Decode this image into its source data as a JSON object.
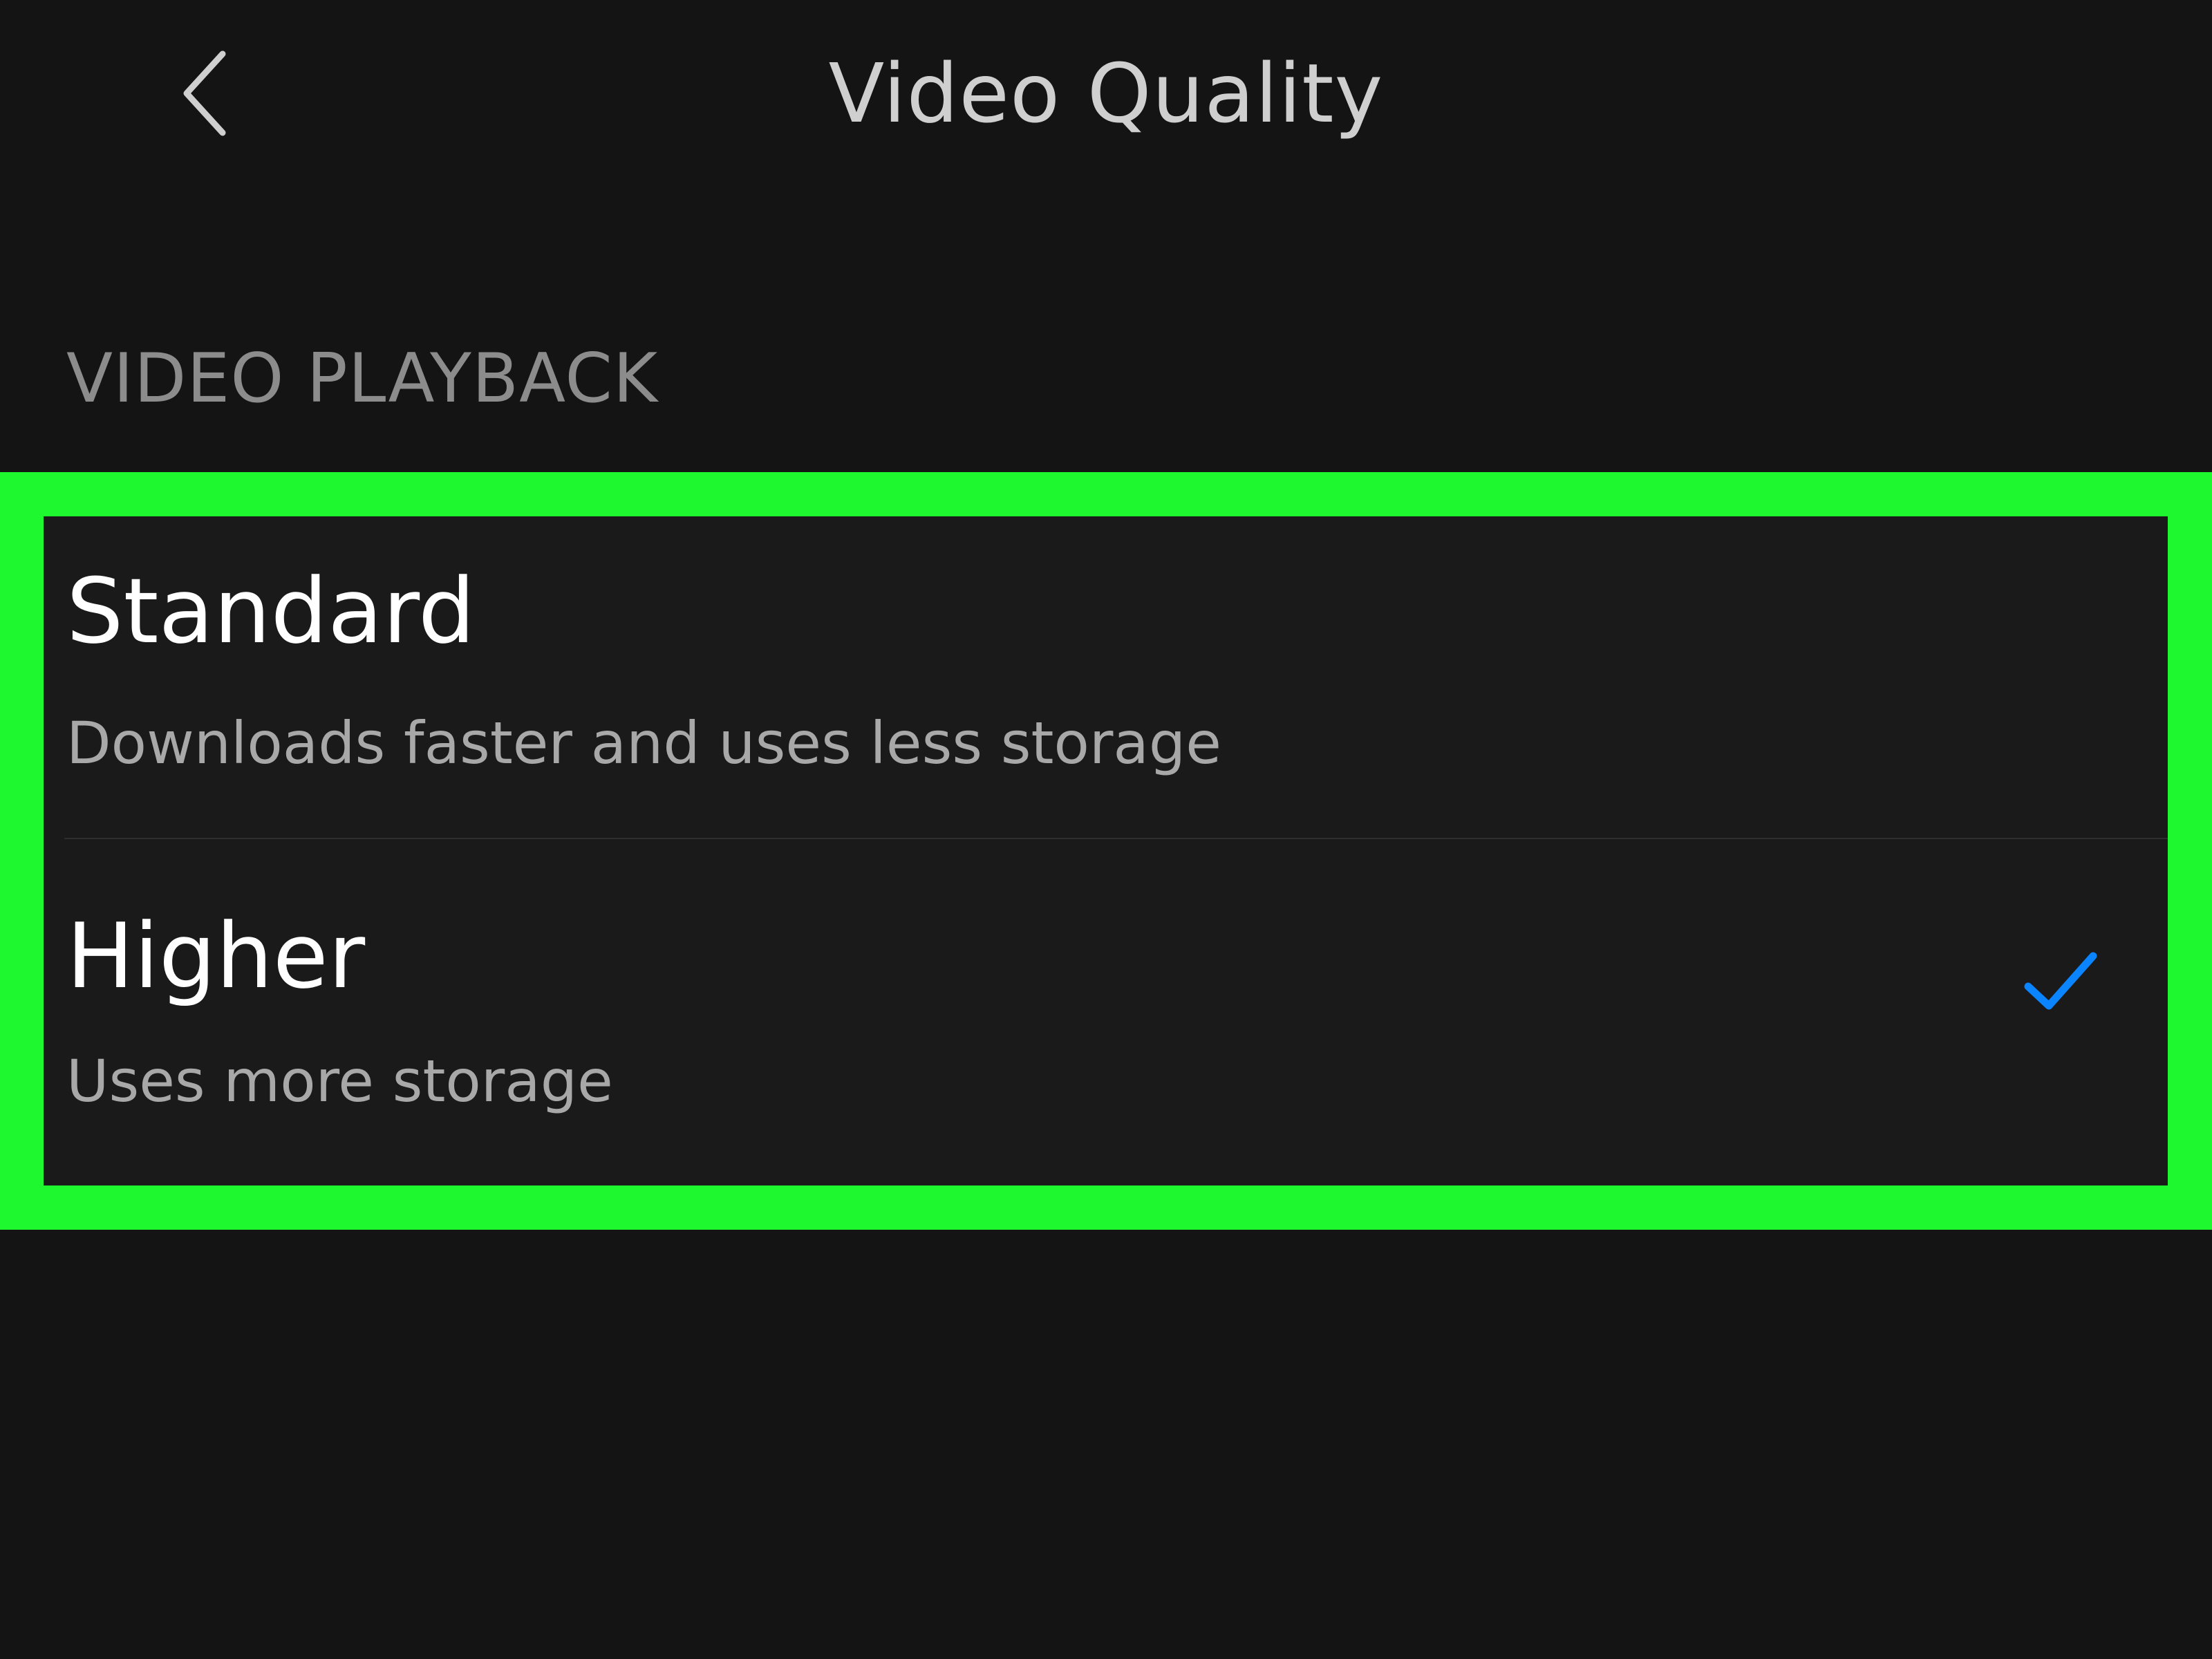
{
  "header": {
    "title": "Video Quality",
    "back_icon": "chevron-left-icon"
  },
  "section": {
    "label": "VIDEO PLAYBACK"
  },
  "options": [
    {
      "title": "Standard",
      "description": "Downloads faster and uses less storage",
      "selected": false
    },
    {
      "title": "Higher",
      "description": "Uses more storage",
      "selected": true
    }
  ],
  "colors": {
    "background": "#141414",
    "highlight": "#1ef92f",
    "panel": "#1a1a1a",
    "checkmark": "#0a84ff"
  },
  "icons": {
    "selected": "checkmark-icon"
  }
}
